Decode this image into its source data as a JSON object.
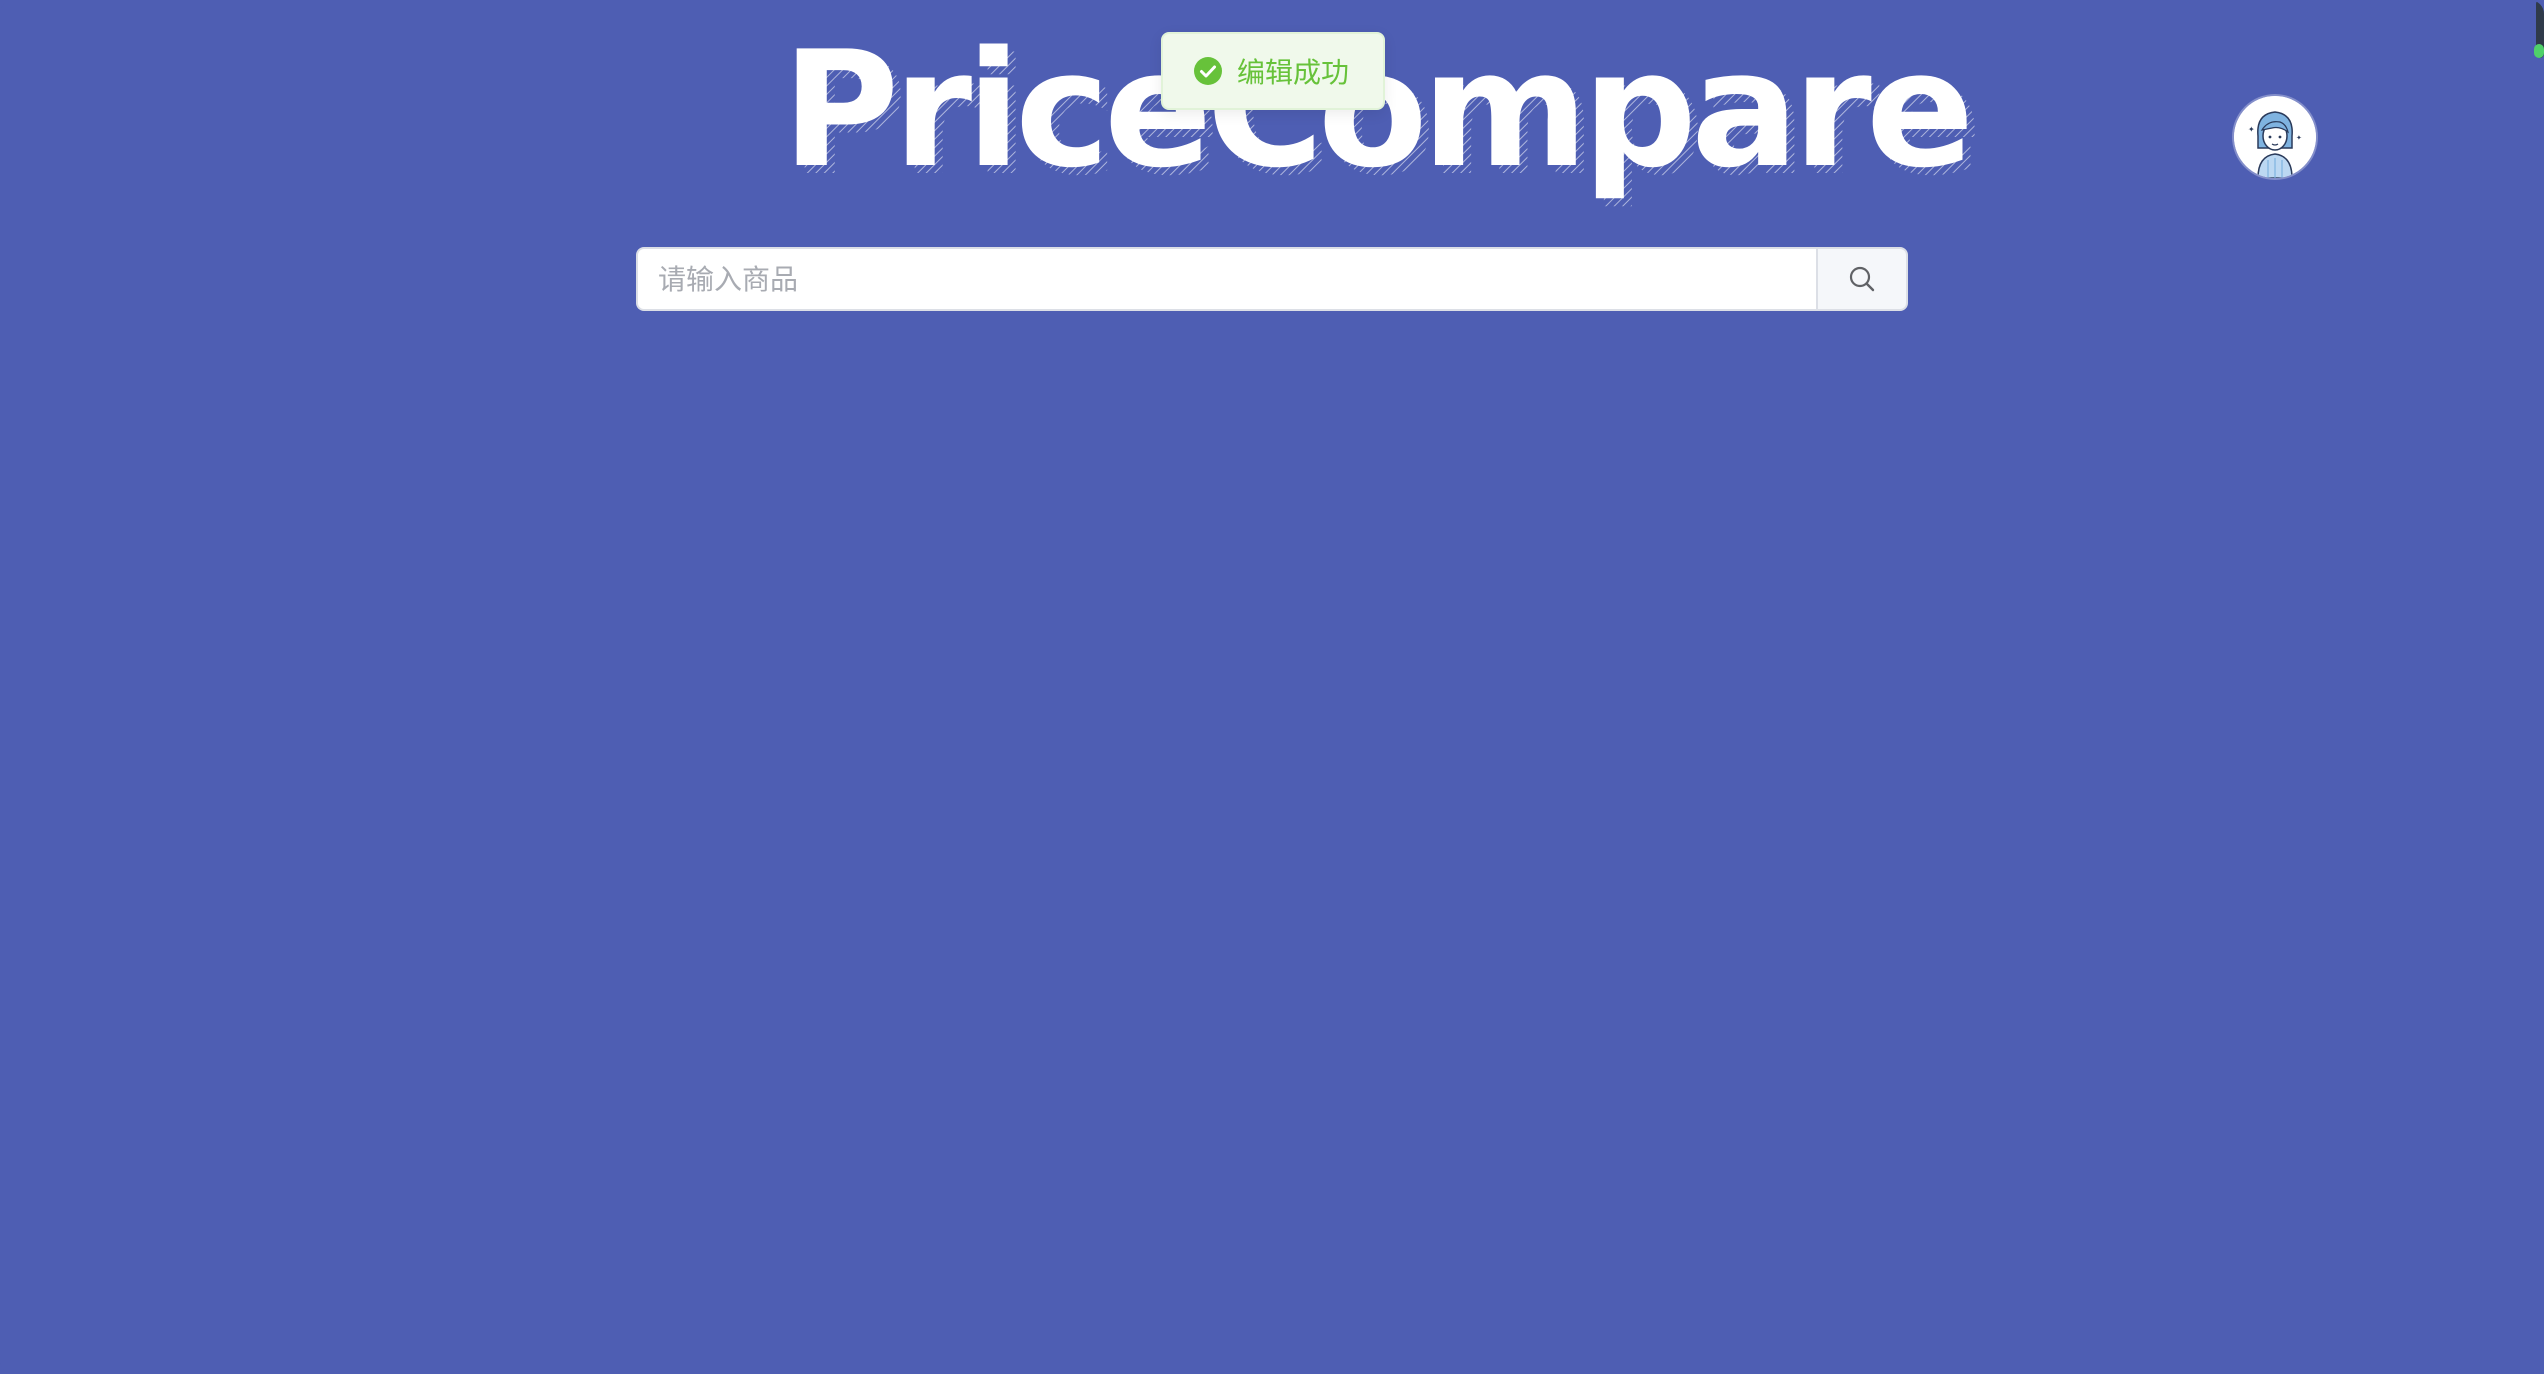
{
  "header": {
    "logo_text": "PriceCompare"
  },
  "search": {
    "placeholder": "请输入商品",
    "value": ""
  },
  "toast": {
    "message": "编辑成功",
    "type": "success"
  },
  "user": {
    "avatar_icon": "user-avatar-icon"
  },
  "colors": {
    "background": "#4e5eb3",
    "toast_bg": "#f0f9eb",
    "toast_text": "#67c23a",
    "logo": "#ffffff"
  }
}
